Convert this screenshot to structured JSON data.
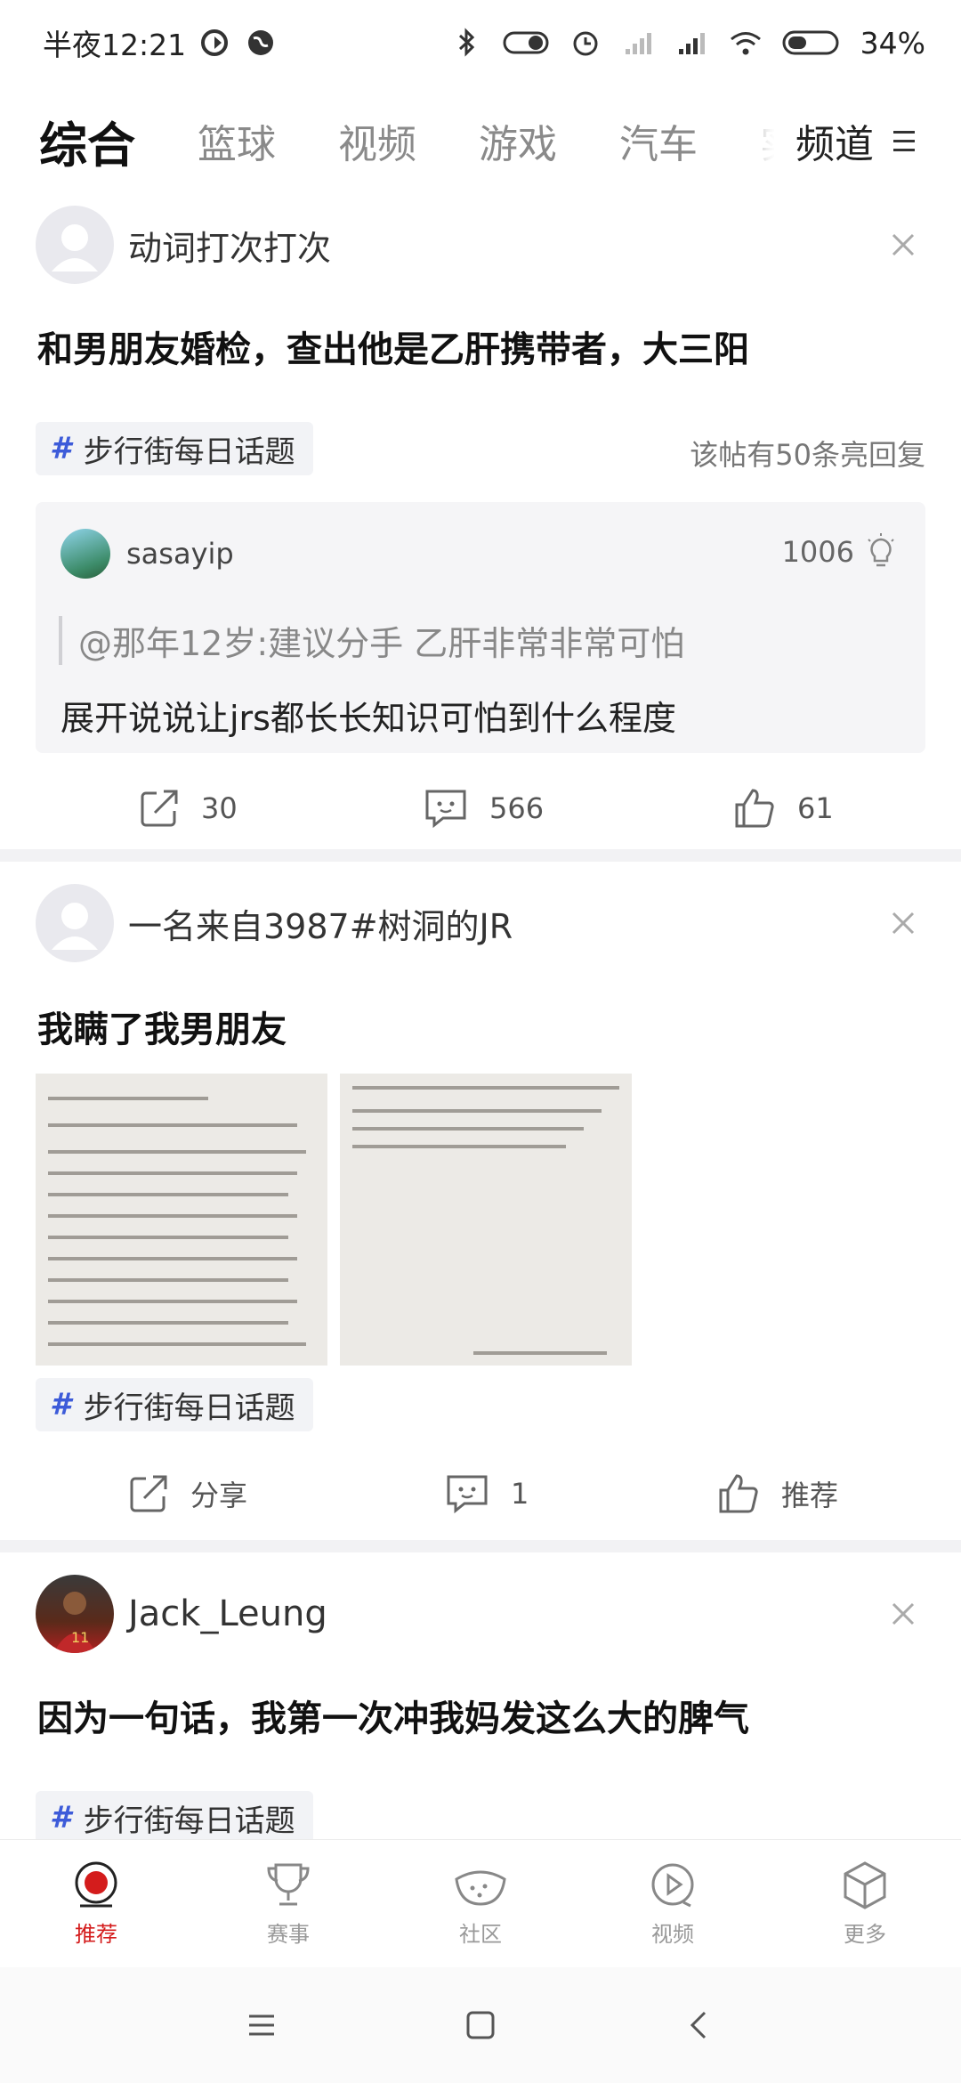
{
  "status_bar": {
    "time": "半夜12:21",
    "battery": "34%"
  },
  "tabs": {
    "items": [
      "综合",
      "篮球",
      "视频",
      "游戏",
      "汽车",
      "实战篮球"
    ],
    "active_index": 0,
    "channel_label": "频道"
  },
  "posts": [
    {
      "author": "动词打次打次",
      "title": "和男朋友婚检，查出他是乙肝携带者，大三阳",
      "topic": "步行街每日话题",
      "hot_replies": "该帖有50条亮回复",
      "quote": {
        "user": "sasayip",
        "light_count": "1006",
        "quoted_text": "@那年12岁:建议分手 乙肝非常非常可怕",
        "reply_text": "展开说说让jrs都长长知识可怕到什么程度"
      },
      "share": "30",
      "comments": "566",
      "likes": "61"
    },
    {
      "author": "一名来自3987#树洞的JR",
      "title": "我瞒了我男朋友",
      "topic": "步行街每日话题",
      "share": "分享",
      "comments": "1",
      "likes": "推荐"
    },
    {
      "author": "Jack_Leung",
      "title": "因为一句话，我第一次冲我妈发这么大的脾气",
      "topic": "步行街每日话题"
    }
  ],
  "bottom_nav": [
    {
      "label": "推荐",
      "icon": "recommend-icon"
    },
    {
      "label": "赛事",
      "icon": "trophy-icon"
    },
    {
      "label": "社区",
      "icon": "watermelon-icon"
    },
    {
      "label": "视频",
      "icon": "video-icon"
    },
    {
      "label": "更多",
      "icon": "cube-icon"
    }
  ],
  "colors": {
    "accent": "#d41c1c",
    "topic_hash": "#3d5bd9",
    "divider": "#f2f2f4"
  }
}
